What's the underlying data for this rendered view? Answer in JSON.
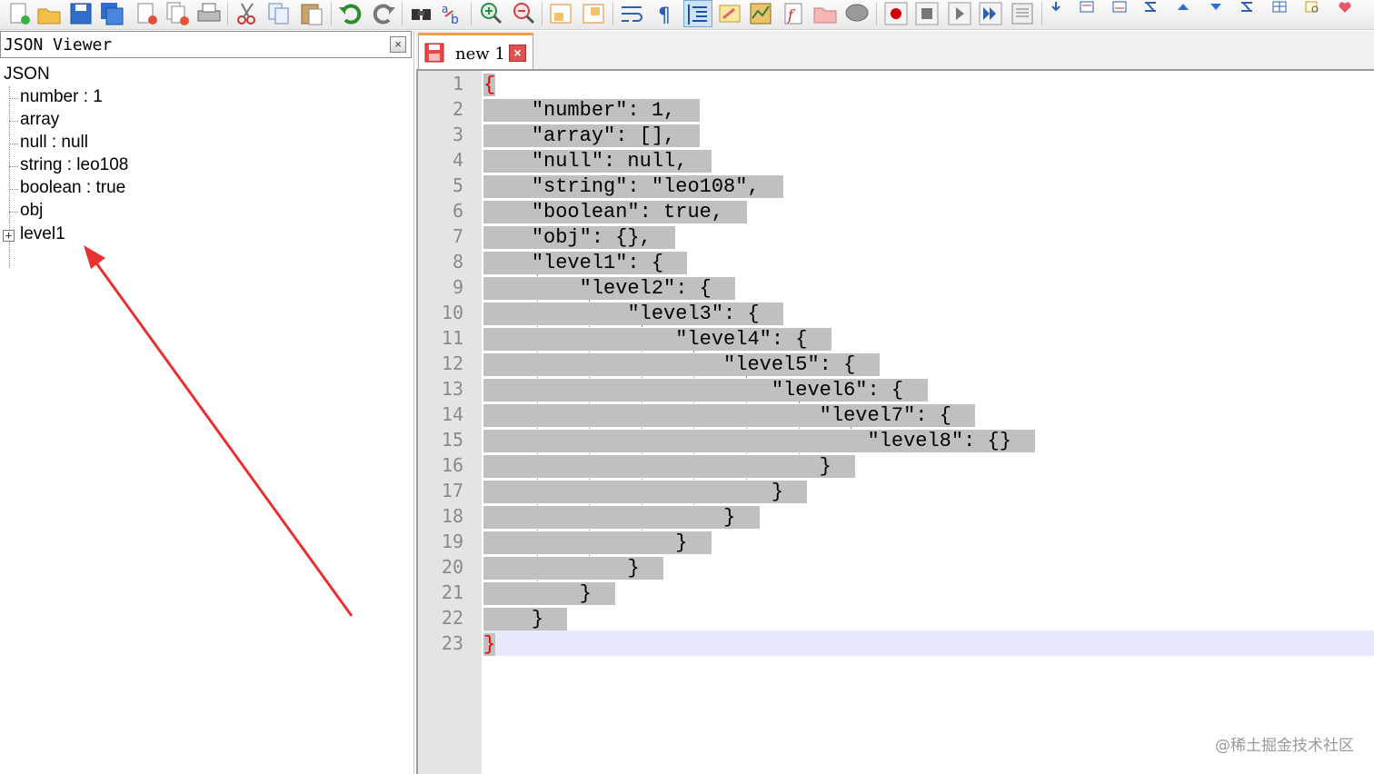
{
  "panel": {
    "title": "JSON Viewer",
    "close_glyph": "×"
  },
  "tree": {
    "root": "JSON",
    "items": [
      "number : 1",
      "array",
      "null : null",
      "string : leo108",
      "boolean : true",
      "obj",
      "level1"
    ],
    "expander_glyph": "+"
  },
  "tab": {
    "label": "new 1",
    "close_glyph": "×"
  },
  "editor": {
    "lines": [
      "{",
      "    \"number\": 1,",
      "    \"array\": [],",
      "    \"null\": null,",
      "    \"string\": \"leo108\",",
      "    \"boolean\": true,",
      "    \"obj\": {},",
      "    \"level1\": {",
      "        \"level2\": {",
      "            \"level3\": {",
      "                \"level4\": {",
      "                    \"level5\": {",
      "                        \"level6\": {",
      "                            \"level7\": {",
      "                                \"level8\": {}",
      "                            }",
      "                        }",
      "                    }",
      "                }",
      "            }",
      "        }",
      "    }",
      "}"
    ],
    "line_numbers": [
      "1",
      "2",
      "3",
      "4",
      "5",
      "6",
      "7",
      "8",
      "9",
      "10",
      "11",
      "12",
      "13",
      "14",
      "15",
      "16",
      "17",
      "18",
      "19",
      "20",
      "21",
      "22",
      "23"
    ]
  },
  "toolbar": {
    "icons": [
      "new-file-icon",
      "open-file-icon",
      "save-icon",
      "save-all-icon",
      "close-icon",
      "close-all-icon",
      "print-icon",
      "cut-icon",
      "copy-icon",
      "paste-icon",
      "undo-icon",
      "redo-icon",
      "find-icon",
      "replace-icon",
      "zoom-in-icon",
      "zoom-out-icon",
      "sync-vertical-icon",
      "sync-horizontal-icon",
      "word-wrap-icon",
      "show-all-chars-icon",
      "indent-guide-icon",
      "user-language-icon",
      "doc-map-icon",
      "function-list-icon",
      "folder-workspace-icon",
      "monitoring-icon",
      "record-macro-icon",
      "stop-macro-icon",
      "play-macro-icon",
      "run-macro-icon",
      "save-macro-icon"
    ]
  },
  "colors": {
    "selection": "#c0c0c0",
    "current_line": "#e8e8ff",
    "brace": "#e00000",
    "gutter": "#e4e4e4",
    "arrow": "#e8312f"
  },
  "watermark": "@稀土掘金技术社区"
}
